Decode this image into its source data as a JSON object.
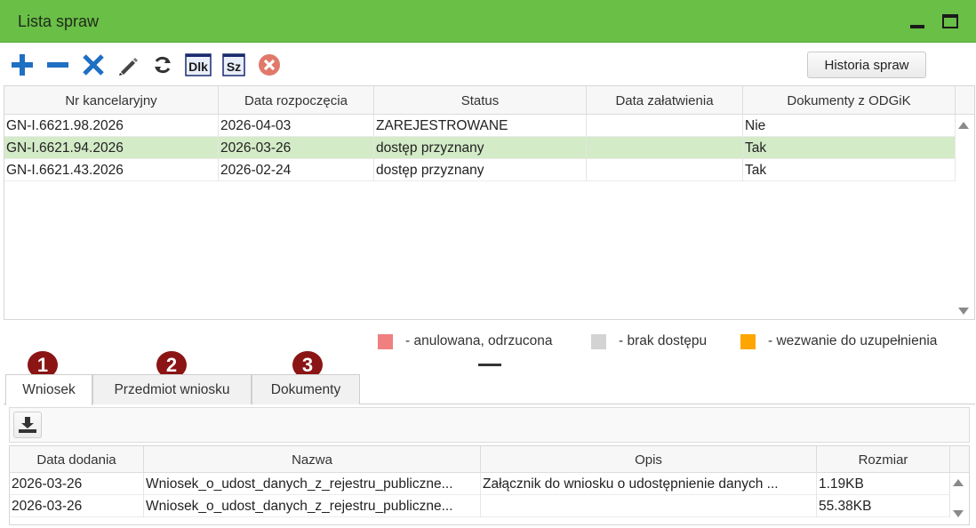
{
  "window": {
    "title": "Lista spraw"
  },
  "toolbar": {
    "buttons": [
      {
        "icon": "plus-icon"
      },
      {
        "icon": "minus-icon"
      },
      {
        "icon": "x-icon"
      },
      {
        "icon": "pencil-icon"
      },
      {
        "icon": "refresh-icon"
      },
      {
        "icon": "dlk-icon",
        "label": "Dlk"
      },
      {
        "icon": "sz-icon",
        "label": "Sz"
      },
      {
        "icon": "cancel-icon"
      }
    ],
    "history_label": "Historia spraw"
  },
  "cases": {
    "columns": [
      "Nr kancelaryjny",
      "Data rozpoczęcia",
      "Status",
      "Data załatwienia",
      "Dokumenty z ODGiK"
    ],
    "rows": [
      {
        "nr": "GN-I.6621.98.2026",
        "start": "2026-04-03",
        "status": "ZAREJESTROWANE",
        "done": "",
        "odgik": "Nie"
      },
      {
        "nr": "GN-I.6621.94.2026",
        "start": "2026-03-26",
        "status": "dostęp przyznany",
        "done": "",
        "odgik": "Tak"
      },
      {
        "nr": "GN-I.6621.43.2026",
        "start": "2026-02-24",
        "status": "dostęp przyznany",
        "done": "",
        "odgik": "Tak"
      }
    ],
    "selected_row": 1
  },
  "legend": [
    {
      "color": "#f08080",
      "label": "- anulowana, odrzucona"
    },
    {
      "color": "#d3d3d3",
      "label": "- brak dostępu"
    },
    {
      "color": "#ffa500",
      "label": "- wezwanie do uzupełnienia"
    }
  ],
  "badges": [
    "1",
    "2",
    "3"
  ],
  "tabs": [
    "Wniosek",
    "Przedmiot wniosku",
    "Dokumenty"
  ],
  "active_tab": 0,
  "attachments": {
    "columns": [
      "Data dodania",
      "Nazwa",
      "Opis",
      "Rozmiar"
    ],
    "rows": [
      {
        "date": "2026-03-26",
        "name": "Wniosek_o_udost_danych_z_rejestru_publiczne...",
        "desc": "Załącznik do wniosku o udostępnienie danych ...",
        "size": "1.19KB"
      },
      {
        "date": "2026-03-26",
        "name": "Wniosek_o_udost_danych_z_rejestru_publiczne...",
        "desc": "",
        "size": "55.38KB"
      }
    ]
  },
  "colors": {
    "titlebar": "#6abf47",
    "selected_row": "#d3ebc7",
    "badge": "#8b1414",
    "icon_blue": "#1f6fc2"
  }
}
